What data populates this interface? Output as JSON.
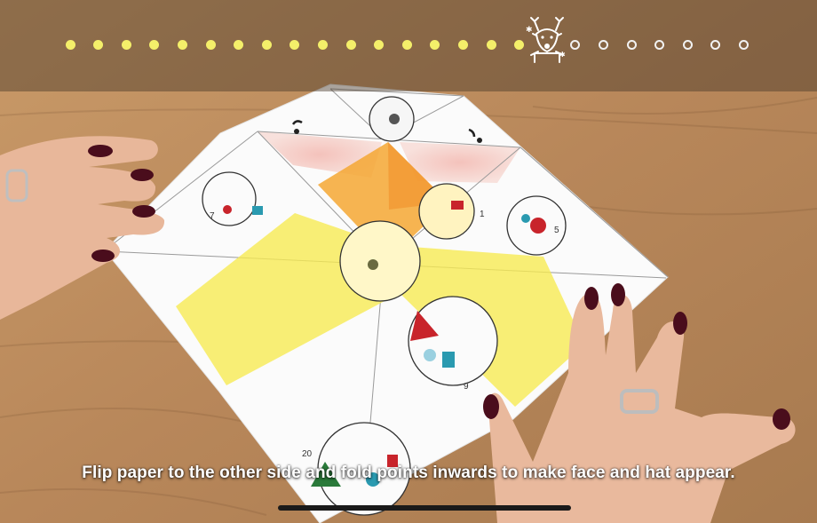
{
  "progress": {
    "total_steps": 25,
    "completed_steps": 17,
    "current_step_icon": "reindeer-icon",
    "done_color": "#f4ef6a",
    "todo_color": "#f2f2f2"
  },
  "caption": {
    "text": "Flip paper to the other side and fold points inwards to make face and hat appear."
  },
  "paper_numbers": [
    "1",
    "5",
    "20",
    "9",
    "7"
  ]
}
